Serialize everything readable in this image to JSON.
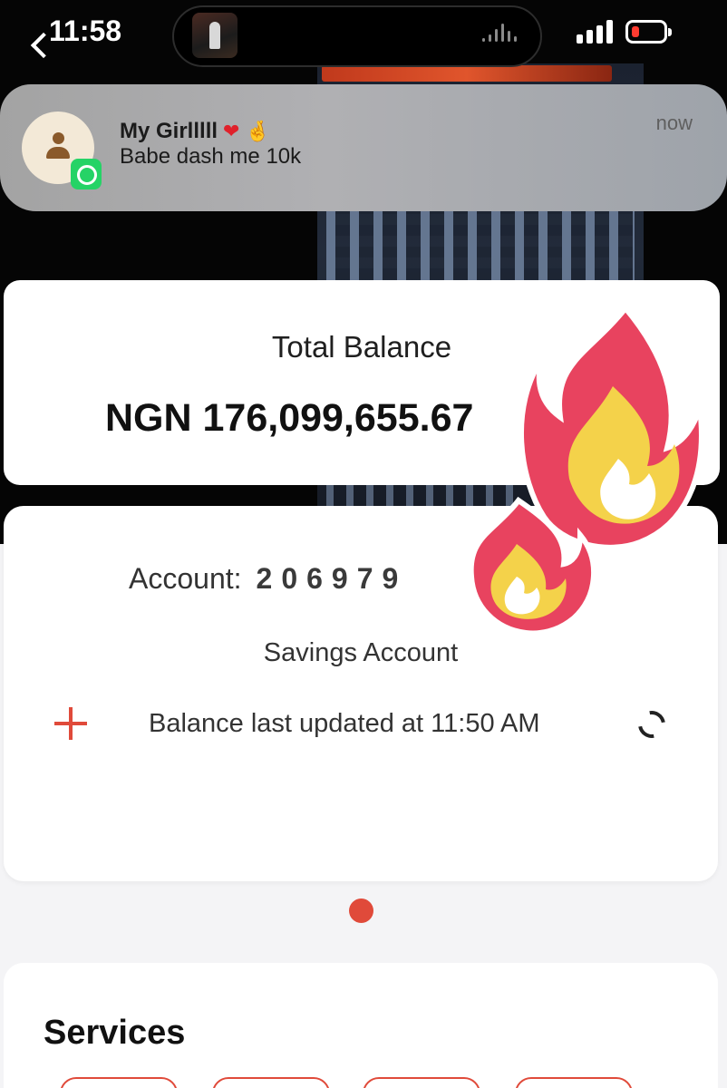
{
  "status_bar": {
    "time": "11:58"
  },
  "notification": {
    "app_icon": "whatsapp-icon",
    "sender": "My Girlllll",
    "sender_emojis": [
      "❤",
      "🤞"
    ],
    "message": "Babe dash me 10k",
    "time": "now"
  },
  "balance_card": {
    "label": "Total Balance",
    "amount": "NGN 176,099,655.67"
  },
  "account_card": {
    "account_label": "Account:",
    "account_number": "206979",
    "account_type": "Savings Account",
    "balance_updated": "Balance last updated at 11:50 AM",
    "add_icon": "plus-icon",
    "refresh_icon": "refresh-icon"
  },
  "services": {
    "title": "Services"
  },
  "colors": {
    "accent": "#e04a3a",
    "whatsapp": "#25d366"
  },
  "overlay_sticker": "fire-emoji"
}
